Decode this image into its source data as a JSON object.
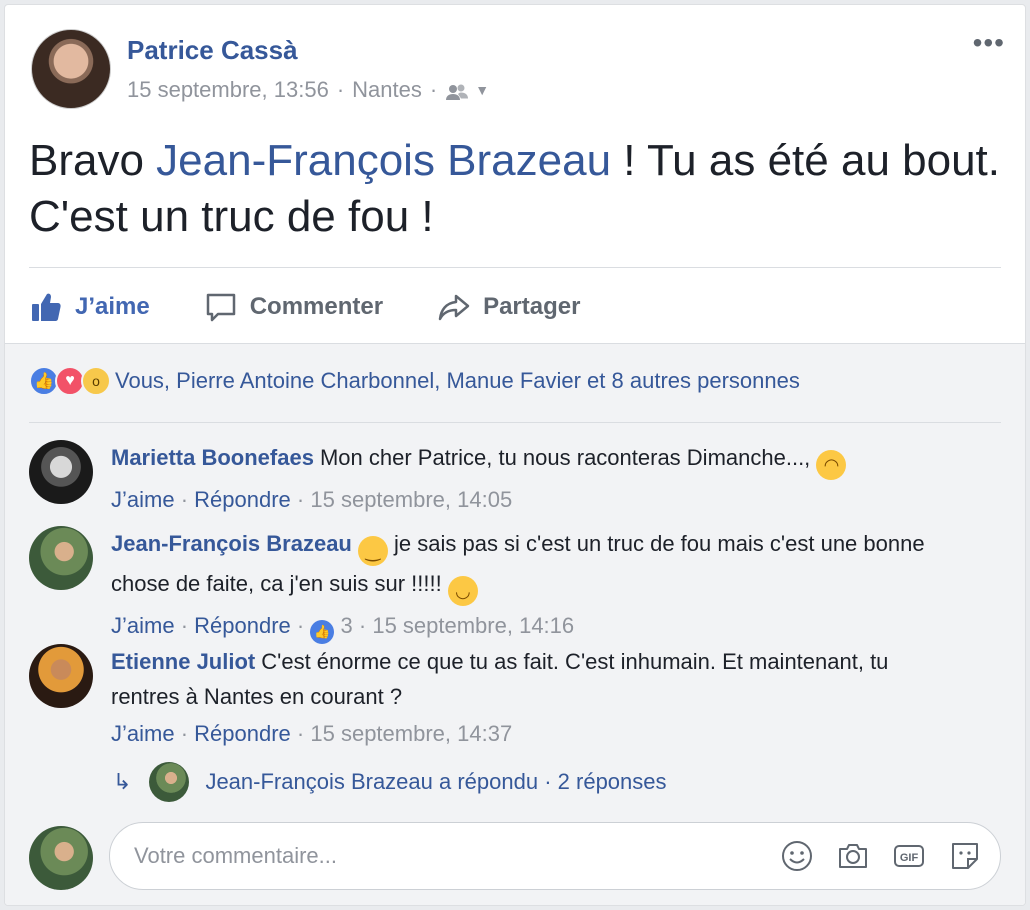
{
  "post": {
    "author": "Patrice Cassà",
    "timestamp": "15 septembre, 13:56",
    "location": "Nantes",
    "audience_icon": "friends-icon",
    "more_icon": "more-dots-icon",
    "text_before": "Bravo ",
    "mention": "Jean-François Brazeau",
    "text_after": " ! Tu as été au bout. C'est un truc de fou !"
  },
  "actions": {
    "like": "J’aime",
    "comment": "Commenter",
    "share": "Partager"
  },
  "reactions": {
    "summary": "Vous, Pierre Antoine Charbonnel, Manue Favier et 8 autres personnes",
    "icons": [
      "like-reaction-icon",
      "love-reaction-icon",
      "wow-reaction-icon"
    ]
  },
  "comments": [
    {
      "name": "Marietta Boonefaes",
      "text": "Mon cher Patrice, tu nous raconteras Dimanche...,",
      "like": "J’aime",
      "reply": "Répondre",
      "time": "15 septembre, 14:05"
    },
    {
      "name": "Jean-François Brazeau",
      "text": "je sais pas si c'est un truc de fou mais c'est une bonne chose de faite, ca j'en suis sur !!!!!",
      "like": "J’aime",
      "reply": "Répondre",
      "likes_count": "3",
      "time": "15 septembre, 14:16"
    },
    {
      "name": "Etienne Juliot",
      "text": "C'est énorme ce que tu as fait. C'est inhumain. Et maintenant, tu rentres à Nantes en courant ?",
      "like": "J’aime",
      "reply": "Répondre",
      "time": "15 septembre, 14:37"
    }
  ],
  "reply_thread": {
    "text": "Jean-François Brazeau a répondu",
    "count": "2 réponses"
  },
  "composer": {
    "placeholder": "Votre commentaire...",
    "icons": [
      "emoji-icon",
      "camera-icon",
      "gif-icon",
      "sticker-icon"
    ]
  }
}
